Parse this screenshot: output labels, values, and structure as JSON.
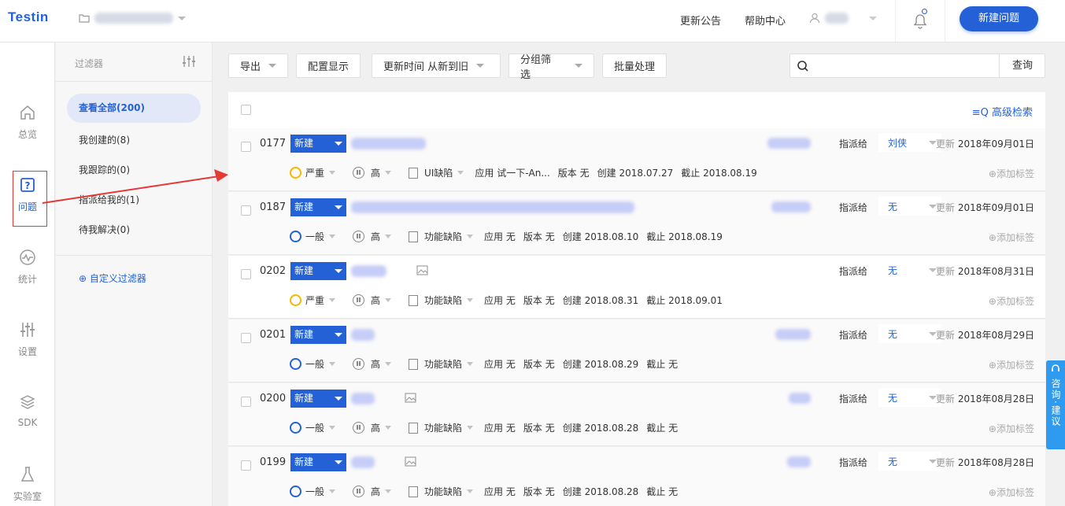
{
  "brand": {
    "logo_text": "Testin",
    "accent": "#2461d6"
  },
  "topbar": {
    "links": [
      "更新公告",
      "帮助中心"
    ],
    "new_issue": "新建问题"
  },
  "leftnav": [
    {
      "label": "总览",
      "icon": "home-icon"
    },
    {
      "label": "问题",
      "icon": "question-box-icon",
      "active": true
    },
    {
      "label": "统计",
      "icon": "pulse-icon"
    },
    {
      "label": "设置",
      "icon": "sliders-icon"
    },
    {
      "label": "SDK",
      "icon": "layers-icon"
    },
    {
      "label": "实验室",
      "icon": "flask-icon"
    }
  ],
  "filters": {
    "title": "过滤器",
    "items": [
      "查看全部(200)",
      "我创建的(8)",
      "我跟踪的(0)",
      "指派给我的(1)",
      "待我解决(0)"
    ],
    "custom": "自定义过滤器"
  },
  "toolbar": {
    "export": "导出",
    "config": "配置显示",
    "sort": "更新时间 从新到旧",
    "group": "分组筛选",
    "batch": "批量处理",
    "search_placeholder": "",
    "search_btn": "查询",
    "advanced": "高级检索"
  },
  "labels": {
    "assign": "指派给",
    "updated": "更新",
    "app": "应用",
    "version": "版本",
    "created": "创建",
    "deadline": "截止",
    "add_tag": "添加标签"
  },
  "rows": [
    {
      "id": "0177",
      "status": "新建",
      "assignee": "刘侠",
      "updated": "2018年09月01日",
      "severity": "严重",
      "severity_color": "#f5b800",
      "priority": "高",
      "type": "UI缺陷",
      "app": "试一下-An...",
      "version": "无",
      "created": "2018.07.27",
      "deadline": "2018.08.19"
    },
    {
      "id": "0187",
      "status": "新建",
      "assignee": "无",
      "updated": "2018年09月01日",
      "severity": "一般",
      "severity_color": "#2461d6",
      "priority": "高",
      "type": "功能缺陷",
      "app": "无",
      "version": "无",
      "created": "2018.08.10",
      "deadline": "2018.08.19"
    },
    {
      "id": "0202",
      "status": "新建",
      "assignee": "无",
      "updated": "2018年08月31日",
      "severity": "严重",
      "severity_color": "#f5b800",
      "priority": "高",
      "type": "功能缺陷",
      "app": "无",
      "version": "无",
      "created": "2018.08.31",
      "deadline": "2018.09.01"
    },
    {
      "id": "0201",
      "status": "新建",
      "assignee": "无",
      "updated": "2018年08月29日",
      "severity": "一般",
      "severity_color": "#2461d6",
      "priority": "高",
      "type": "功能缺陷",
      "app": "无",
      "version": "无",
      "created": "2018.08.29",
      "deadline": "无"
    },
    {
      "id": "0200",
      "status": "新建",
      "assignee": "无",
      "updated": "2018年08月28日",
      "severity": "一般",
      "severity_color": "#2461d6",
      "priority": "高",
      "type": "功能缺陷",
      "app": "无",
      "version": "无",
      "created": "2018.08.28",
      "deadline": "无"
    },
    {
      "id": "0199",
      "status": "新建",
      "assignee": "无",
      "updated": "2018年08月28日",
      "severity": "一般",
      "severity_color": "#2461d6",
      "priority": "高",
      "type": "功能缺陷",
      "app": "无",
      "version": "无",
      "created": "2018.08.28",
      "deadline": "无"
    }
  ],
  "side_tab": "咨询·建议"
}
